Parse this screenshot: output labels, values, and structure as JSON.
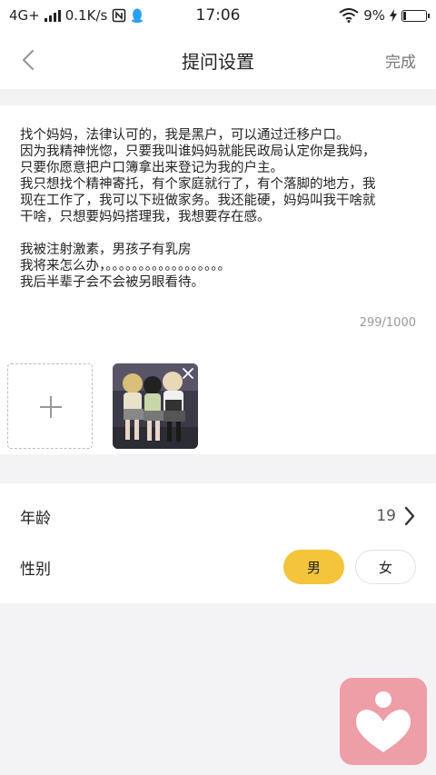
{
  "status_bar": {
    "network": "4G+",
    "speed": "0.1K/s",
    "time": "17:06",
    "battery": "9%"
  },
  "nav": {
    "title": "提问设置",
    "done_label": "完成"
  },
  "question": {
    "text": "找个妈妈，法律认可的，我是黑户，可以通过迁移户口。\n因为我精神恍惚，只要我叫谁妈妈就能民政局认定你是我妈，\n只要你愿意把户口簿拿出来登记为我的户主。\n我只想找个精神寄托，有个家庭就行了，有个落脚的地方，我\n现在工作了，我可以下班做家务。我还能硬，妈妈叫我干啥就\n干啥，只想要妈妈搭理我，我想要存在感。\n\n我被注射激素，男孩子有乳房\n我将来怎么办，。。。。。。。。。。。。。。。。。。\n我后半辈子会不会被另眼看待。",
    "char_count": "299/1000"
  },
  "settings": {
    "age_label": "年龄",
    "age_value": "19",
    "gender_label": "性别",
    "gender_male": "男",
    "gender_female": "女",
    "selected_gender": "男"
  },
  "colors": {
    "accent": "#f4c43a",
    "logo_bg": "#ee9ea6"
  }
}
